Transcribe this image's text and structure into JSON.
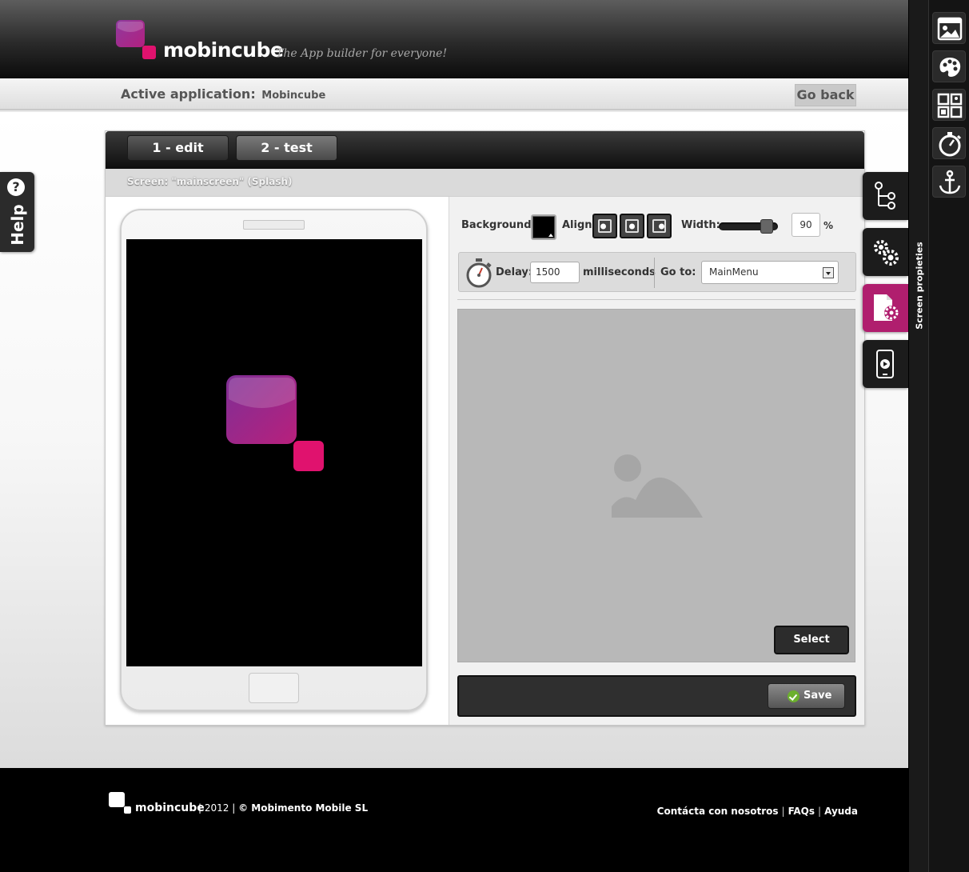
{
  "header": {
    "brand_name": "mobincube",
    "tagline": "The App builder for everyone!"
  },
  "appbar": {
    "label": "Active application:",
    "app_name": "Mobincube",
    "go_back_label": "Go back"
  },
  "help": {
    "icon": "question-circle-icon",
    "label": "Help"
  },
  "editor": {
    "tabs": [
      {
        "label": "1 - edit"
      },
      {
        "label": "2 - test"
      }
    ],
    "screen_label": "Screen: \"mainscreen\" (Splash)"
  },
  "properties": {
    "background_label": "Background:",
    "background_color": "#000000",
    "align_label": "Align:",
    "align_options": [
      "left",
      "center",
      "right"
    ],
    "width_label": "Width:",
    "width_value": "90",
    "width_unit": "%",
    "delay_label": "Delay:",
    "delay_value": "1500",
    "delay_unit": "milliseconds",
    "goto_label": "Go to:",
    "goto_value": "MainMenu",
    "select_label": "Select",
    "save_label": "Save"
  },
  "side_tabs": [
    {
      "name": "structure",
      "icon": "tree-icon"
    },
    {
      "name": "settings",
      "icon": "gears-icon"
    },
    {
      "name": "screen-properties",
      "icon": "document-gear-icon",
      "active": true
    },
    {
      "name": "preview",
      "icon": "phone-play-icon"
    }
  ],
  "props_strip": {
    "label": "Screen propieties"
  },
  "toolbar": [
    {
      "name": "image",
      "icon": "image-icon"
    },
    {
      "name": "palette",
      "icon": "palette-icon"
    },
    {
      "name": "widgets",
      "icon": "widgets-icon"
    },
    {
      "name": "timer",
      "icon": "stopwatch-icon"
    },
    {
      "name": "anchor",
      "icon": "anchor-icon"
    }
  ],
  "footer": {
    "brand_name": "mobincube",
    "year": "2012",
    "company": "© Mobimento Mobile SL",
    "links": [
      "Contácta con nosotros",
      "FAQs",
      "Ayuda"
    ]
  },
  "colors": {
    "accent": "#b01e6e",
    "logo_purple": "#7b2d8f",
    "logo_pink": "#e0126e"
  }
}
